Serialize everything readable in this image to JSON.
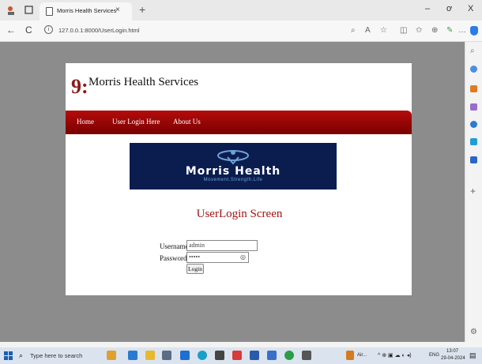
{
  "browser": {
    "tab_title": "Morris Health Services",
    "tab_close": "×",
    "new_tab": "+",
    "url": "127.0.0.1:8000/UserLogin.html",
    "win_min": "–",
    "win_max": "ơ",
    "win_close": "X"
  },
  "site": {
    "logo_mark": "9:",
    "name": "Morris Health Services",
    "nav": [
      "Home",
      "User Login Here",
      "About Us"
    ],
    "banner_title": "Morris Health",
    "banner_sub": "Movement.Strength.Life"
  },
  "login": {
    "title": "UserLogin Screen",
    "username_label": "Username",
    "username_value": "admin",
    "password_label": "Password",
    "password_value": "•••••",
    "button_label": "Login"
  },
  "taskbar": {
    "search_placeholder": "Type here to search",
    "weather": "Air...",
    "lang": "ENG",
    "time": "13:07",
    "date": "29-04-2024"
  },
  "colors": {
    "nav_red": "#a00808",
    "title_red": "#a11313",
    "banner_navy": "#0b1d4f",
    "backdrop": "#8c8c8c"
  }
}
